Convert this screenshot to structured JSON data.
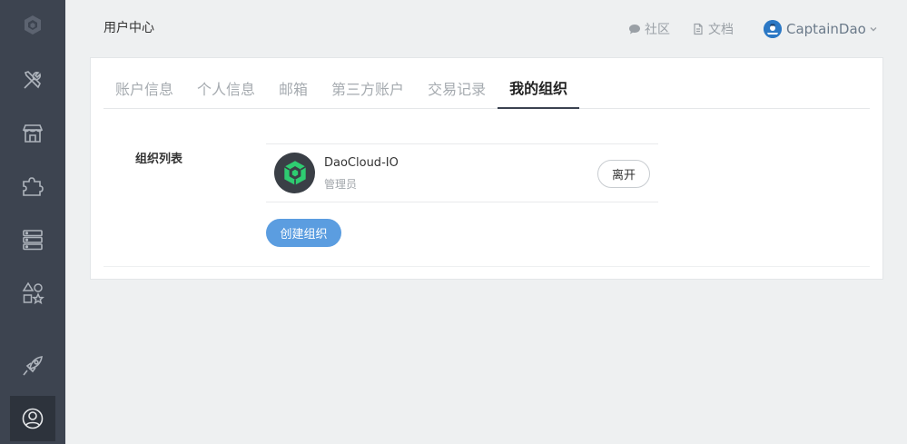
{
  "header": {
    "title": "用户中心",
    "community_label": "社区",
    "docs_label": "文档",
    "username": "CaptainDao"
  },
  "sidebar": {
    "items": [
      {
        "icon": "daocloud-logo-icon"
      },
      {
        "icon": "tools-icon"
      },
      {
        "icon": "store-icon"
      },
      {
        "icon": "puzzle-icon"
      },
      {
        "icon": "server-stack-icon"
      },
      {
        "icon": "shapes-icon"
      },
      {
        "icon": "rocket-icon"
      },
      {
        "icon": "user-circle-icon",
        "active": true
      }
    ]
  },
  "tabs": [
    {
      "label": "账户信息"
    },
    {
      "label": "个人信息"
    },
    {
      "label": "邮箱"
    },
    {
      "label": "第三方账户"
    },
    {
      "label": "交易记录"
    },
    {
      "label": "我的组织",
      "active": true
    }
  ],
  "org_section": {
    "label": "组织列表",
    "orgs": [
      {
        "name": "DaoCloud-IO",
        "role": "管理员",
        "leave_label": "离开"
      }
    ],
    "create_label": "创建组织"
  },
  "colors": {
    "sidebar_bg": "#3d4450",
    "primary_button": "#5b9de0",
    "page_bg": "#eef0f1",
    "logo_green": "#2ecc71"
  }
}
